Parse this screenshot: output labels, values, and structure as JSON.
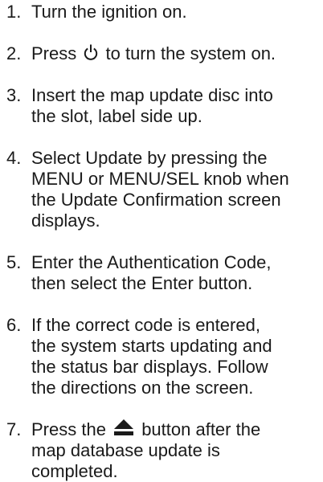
{
  "steps": [
    {
      "num": "1.",
      "lines": [
        "Turn the ignition on."
      ]
    },
    {
      "num": "2.",
      "before_icon": "Press",
      "icon": "power-icon",
      "after_icon": "to turn the system on."
    },
    {
      "num": "3.",
      "lines": [
        "Insert the map update disc into",
        "the slot, label side up."
      ]
    },
    {
      "num": "4.",
      "lines": [
        "Select Update by pressing the",
        "MENU or MENU/SEL knob when",
        "the Update Confirmation screen",
        "displays."
      ]
    },
    {
      "num": "5.",
      "lines": [
        "Enter the Authentication Code,",
        "then select the Enter button."
      ]
    },
    {
      "num": "6.",
      "lines": [
        "If the correct code is entered,",
        "the system starts updating and",
        "the status bar displays. Follow",
        "the directions on the screen."
      ]
    },
    {
      "num": "7.",
      "before_icon": "Press the",
      "icon": "eject-icon",
      "after_icon": "button after the",
      "lines": [
        "map database update is",
        "completed."
      ]
    }
  ]
}
